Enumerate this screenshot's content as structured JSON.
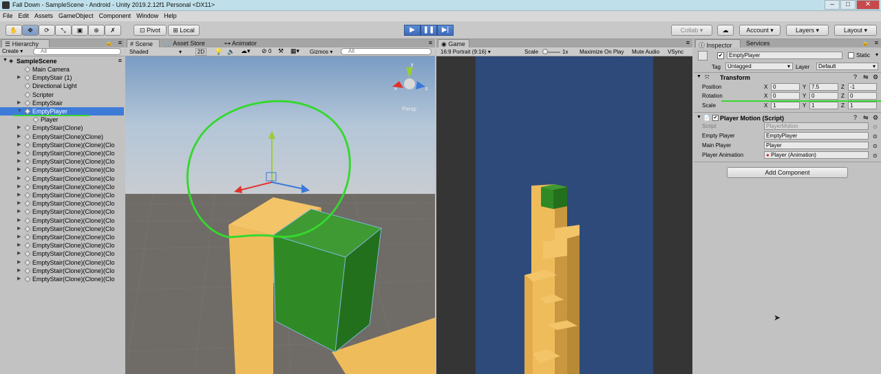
{
  "window": {
    "title": "Fall Down - SampleScene - Android - Unity 2019.2.12f1 Personal <DX11>"
  },
  "menu": [
    "File",
    "Edit",
    "Assets",
    "GameObject",
    "Component",
    "Window",
    "Help"
  ],
  "toolbar": {
    "pivot_label": "Pivot",
    "local_label": "Local",
    "collab_label": "Collab",
    "account_label": "Account",
    "layers_label": "Layers",
    "layout_label": "Layout"
  },
  "hierarchy": {
    "tab_label": "Hierarchy",
    "create_label": "Create",
    "search_placeholder": "All",
    "scene_name": "SampleScene",
    "items": [
      {
        "label": "Main Camera",
        "indent": 1,
        "expandable": false,
        "selected": false
      },
      {
        "label": "EmptyStair (1)",
        "indent": 1,
        "expandable": true,
        "selected": false
      },
      {
        "label": "Directional Light",
        "indent": 1,
        "expandable": false,
        "selected": false
      },
      {
        "label": "Scripter",
        "indent": 1,
        "expandable": false,
        "selected": false
      },
      {
        "label": "EmptyStair",
        "indent": 1,
        "expandable": true,
        "selected": false
      },
      {
        "label": "EmptyPlayer",
        "indent": 1,
        "expandable": true,
        "selected": true
      },
      {
        "label": "Player",
        "indent": 2,
        "expandable": false,
        "selected": false
      },
      {
        "label": "EmptyStair(Clone)",
        "indent": 1,
        "expandable": true,
        "selected": false
      },
      {
        "label": "EmptyStair(Clone)(Clone)",
        "indent": 1,
        "expandable": true,
        "selected": false
      },
      {
        "label": "EmptyStair(Clone)(Clone)(Clo",
        "indent": 1,
        "expandable": true,
        "selected": false
      },
      {
        "label": "EmptyStair(Clone)(Clone)(Clo",
        "indent": 1,
        "expandable": true,
        "selected": false
      },
      {
        "label": "EmptyStair(Clone)(Clone)(Clo",
        "indent": 1,
        "expandable": true,
        "selected": false
      },
      {
        "label": "EmptyStair(Clone)(Clone)(Clo",
        "indent": 1,
        "expandable": true,
        "selected": false
      },
      {
        "label": "EmptyStair(Clone)(Clone)(Clo",
        "indent": 1,
        "expandable": true,
        "selected": false
      },
      {
        "label": "EmptyStair(Clone)(Clone)(Clo",
        "indent": 1,
        "expandable": true,
        "selected": false
      },
      {
        "label": "EmptyStair(Clone)(Clone)(Clo",
        "indent": 1,
        "expandable": true,
        "selected": false
      },
      {
        "label": "EmptyStair(Clone)(Clone)(Clo",
        "indent": 1,
        "expandable": true,
        "selected": false
      },
      {
        "label": "EmptyStair(Clone)(Clone)(Clo",
        "indent": 1,
        "expandable": true,
        "selected": false
      },
      {
        "label": "EmptyStair(Clone)(Clone)(Clo",
        "indent": 1,
        "expandable": true,
        "selected": false
      },
      {
        "label": "EmptyStair(Clone)(Clone)(Clo",
        "indent": 1,
        "expandable": true,
        "selected": false
      },
      {
        "label": "EmptyStair(Clone)(Clone)(Clo",
        "indent": 1,
        "expandable": true,
        "selected": false
      },
      {
        "label": "EmptyStair(Clone)(Clone)(Clo",
        "indent": 1,
        "expandable": true,
        "selected": false
      },
      {
        "label": "EmptyStair(Clone)(Clone)(Clo",
        "indent": 1,
        "expandable": true,
        "selected": false
      },
      {
        "label": "EmptyStair(Clone)(Clone)(Clo",
        "indent": 1,
        "expandable": true,
        "selected": false
      },
      {
        "label": "EmptyStair(Clone)(Clone)(Clo",
        "indent": 1,
        "expandable": true,
        "selected": false
      },
      {
        "label": "EmptyStair(Clone)(Clone)(Clo",
        "indent": 1,
        "expandable": true,
        "selected": false
      }
    ]
  },
  "scene": {
    "tabs": [
      "Scene",
      "Asset Store",
      "Animator"
    ],
    "shading_mode": "Shaded",
    "mode_2d": "2D",
    "gizmos_count": "0",
    "gizmos_label": "Gizmos",
    "search_placeholder": "All",
    "persp_label": "Persp",
    "gizmo_y_label": "y",
    "gizmo_x_label": "x",
    "gizmo_z_label": "z"
  },
  "game": {
    "tab_label": "Game",
    "aspect_label": "16:9 Portrait (9:16)",
    "scale_label": "Scale",
    "scale_value": "1x",
    "maximize_label": "Maximize On Play",
    "mute_label": "Mute Audio",
    "vsync_label": "VSync"
  },
  "inspector": {
    "tabs": [
      "Inspector",
      "Services"
    ],
    "object_name": "EmptyPlayer",
    "static_label": "Static",
    "tag_label": "Tag",
    "tag_value": "Untagged",
    "layer_label": "Layer",
    "layer_value": "Default",
    "transform": {
      "title": "Transform",
      "position_label": "Position",
      "rotation_label": "Rotation",
      "scale_label": "Scale",
      "position": {
        "x": "0",
        "y": "7.5",
        "z": "-1"
      },
      "rotation": {
        "x": "0",
        "y": "0",
        "z": "0"
      },
      "scale": {
        "x": "1",
        "y": "1",
        "z": "1"
      }
    },
    "script_component": {
      "title": "Player Motion (Script)",
      "script_label": "Script",
      "script_value": "PlayerMotion",
      "empty_player_label": "Empty Player",
      "empty_player_value": "EmptyPlayer",
      "main_player_label": "Main Player",
      "main_player_value": "Player",
      "player_animation_label": "Player Animation",
      "player_animation_value": "Player (Animation)"
    },
    "add_component_label": "Add Component"
  },
  "axis_labels": {
    "x": "X",
    "y": "Y",
    "z": "Z"
  },
  "colors": {
    "selection_blue": "#3e7bd8",
    "annotation_green": "#35d82f",
    "game_bg": "#2e4a7a",
    "stair_yellow": "#f2bf5f",
    "player_green": "#2f7a24"
  }
}
